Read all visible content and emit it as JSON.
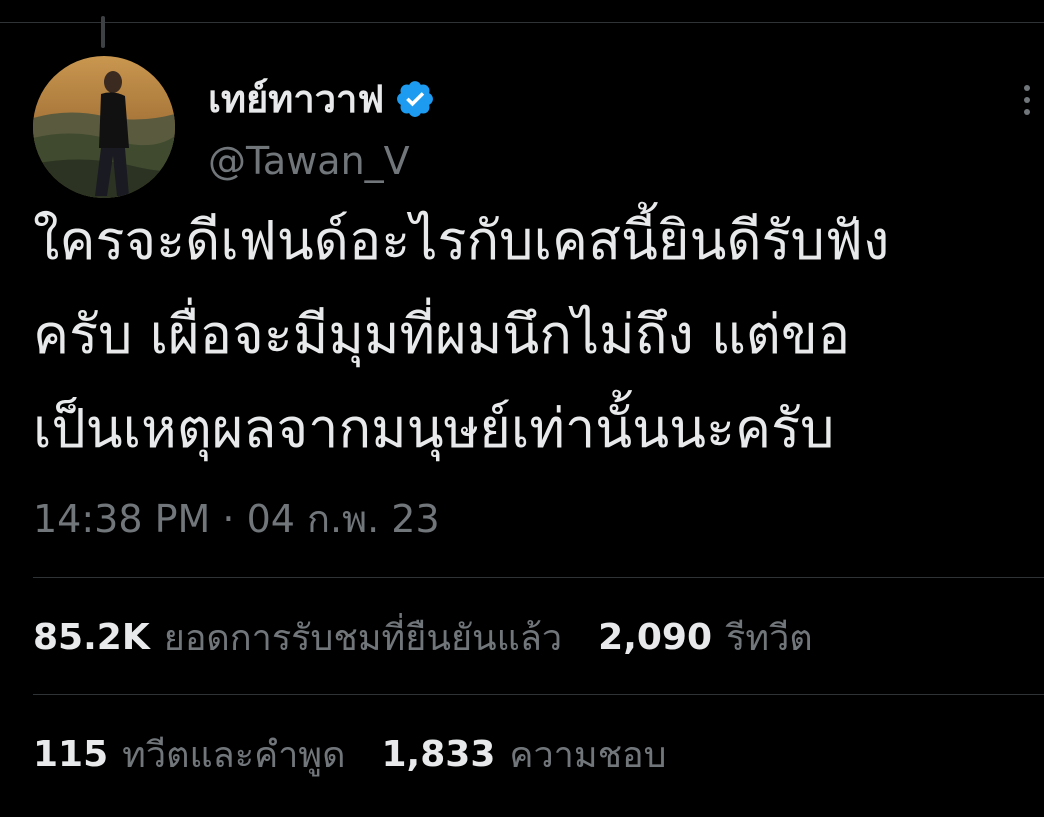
{
  "tweet": {
    "display_name": "เทย์ทาวาฟ",
    "verified_icon": "verified-badge-icon",
    "handle": "@Tawan_V",
    "more_icon": "more-options-icon",
    "text_lines": [
      "ใครจะดีเฟนด์อะไรกับเคสนี้ยินดีรับฟัง",
      "ครับ เผื่อจะมีมุมที่ผมนึกไม่ถึง แต่ขอ",
      "เป็นเหตุผลจากมนุษย์เท่านั้นนะครับ"
    ],
    "time": "14:38 PM",
    "separator": "·",
    "date": "04 ก.พ. 23"
  },
  "stats": {
    "views_count": "85.2K",
    "views_label": "ยอดการรับชมที่ยืนยันแล้ว",
    "retweets_count": "2,090",
    "retweets_label": "รีทวีต",
    "quotes_count": "115",
    "quotes_label": "ทวีตและคำพูด",
    "likes_count": "1,833",
    "likes_label": "ความชอบ"
  },
  "colors": {
    "background": "#000000",
    "primary_text": "#e7e9ea",
    "secondary_text": "#71767b",
    "divider": "#2f3336",
    "verified_blue": "#1d9bf0"
  }
}
